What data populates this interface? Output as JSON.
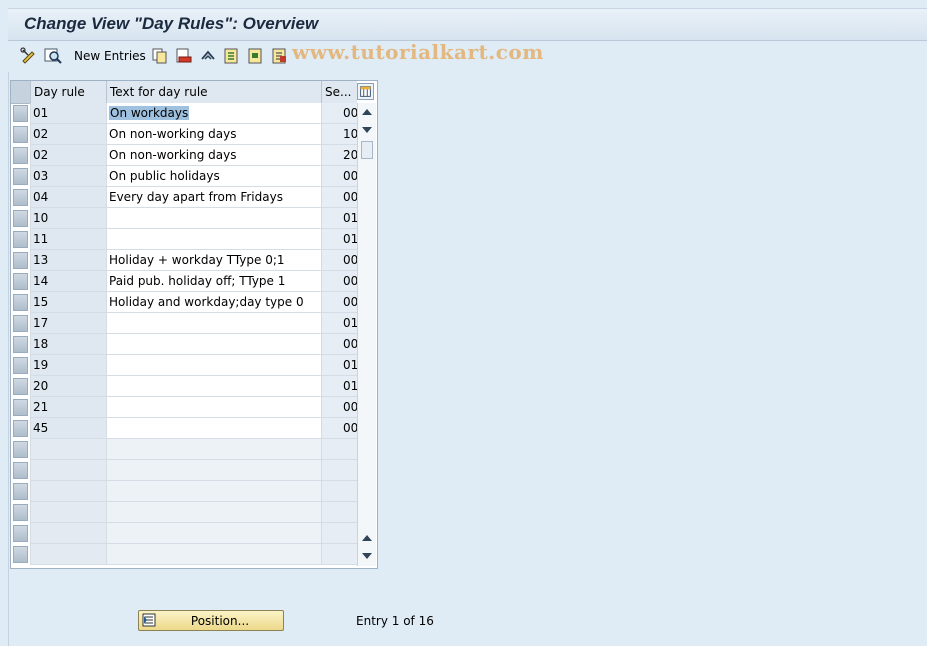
{
  "window": {
    "title": "Change View \"Day Rules\": Overview"
  },
  "toolbar": {
    "new_entries_label": "New Entries",
    "icons": [
      "display-change-icon",
      "find-icon",
      "copy-as-icon",
      "delete-icon",
      "undo-change-icon",
      "select-all-icon",
      "select-block-icon",
      "deselect-all-icon"
    ]
  },
  "watermark": {
    "text": "www.tutorialkart.com"
  },
  "table": {
    "columns": [
      "Day rule",
      "Text for day rule",
      "Se..."
    ],
    "rows": [
      {
        "key": "01",
        "text": "On workdays",
        "seq": "00"
      },
      {
        "key": "02",
        "text": "On non-working days",
        "seq": "10"
      },
      {
        "key": "02",
        "text": "On non-working days",
        "seq": "20"
      },
      {
        "key": "03",
        "text": "On public holidays",
        "seq": "00"
      },
      {
        "key": "04",
        "text": "Every day apart from Fridays",
        "seq": "00"
      },
      {
        "key": "10",
        "text": "",
        "seq": "01"
      },
      {
        "key": "11",
        "text": "",
        "seq": "01"
      },
      {
        "key": "13",
        "text": "Holiday + workday TType 0;1",
        "seq": "00"
      },
      {
        "key": "14",
        "text": "Paid pub. holiday off; TType 1",
        "seq": "00"
      },
      {
        "key": "15",
        "text": "Holiday and workday;day type 0",
        "seq": "00"
      },
      {
        "key": "17",
        "text": "",
        "seq": "01"
      },
      {
        "key": "18",
        "text": "",
        "seq": "00"
      },
      {
        "key": "19",
        "text": "",
        "seq": "01"
      },
      {
        "key": "20",
        "text": "",
        "seq": "01"
      },
      {
        "key": "21",
        "text": "",
        "seq": "00"
      },
      {
        "key": "45",
        "text": "",
        "seq": "00"
      }
    ],
    "empty_rows": 6
  },
  "footer": {
    "position_button_label": "Position...",
    "entry_info": "Entry 1 of 16"
  },
  "colors": {
    "accent": "#9ec1df",
    "button": "#ecd98a",
    "background": "#dfebf5"
  }
}
